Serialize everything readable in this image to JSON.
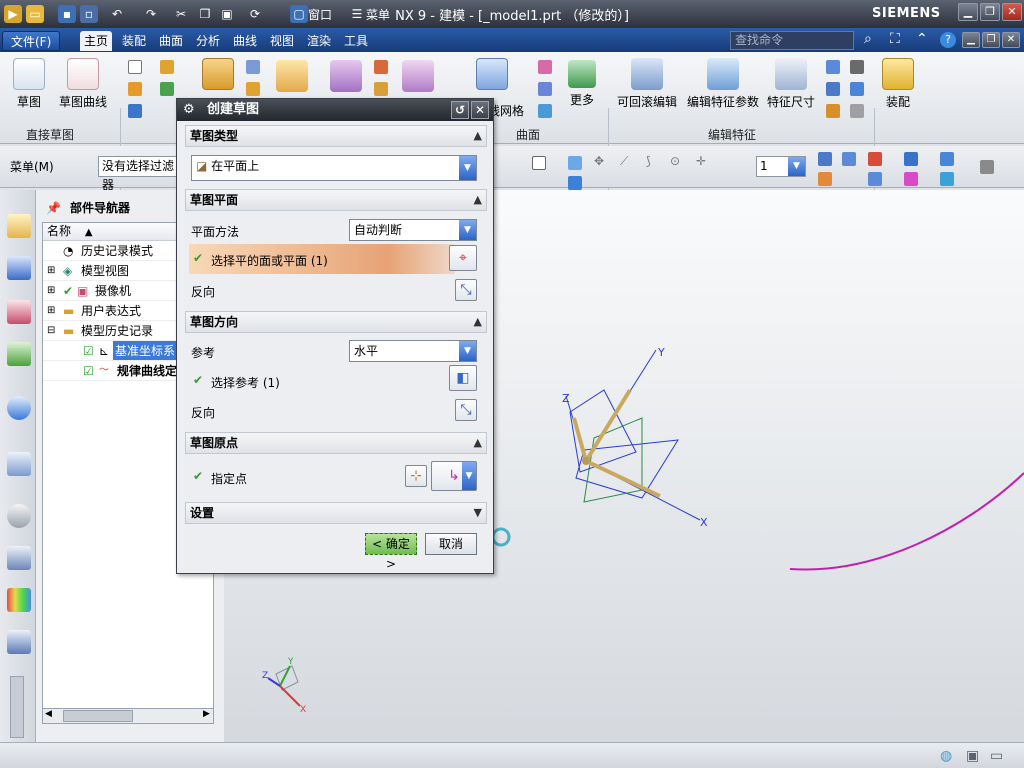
{
  "window": {
    "title": "NX 9 - 建模 - [_model1.prt （修改的）]",
    "brand": "SIEMENS",
    "quick_access": {
      "window_label": "窗口",
      "menu_label": "菜单"
    }
  },
  "menubar": {
    "tabs": [
      "文件(F)",
      "主页",
      "装配",
      "曲面",
      "分析",
      "曲线",
      "视图",
      "渲染",
      "工具"
    ],
    "active_tab": "主页",
    "search_placeholder": "查找命令"
  },
  "ribbon": {
    "buttons": {
      "sketch": "草图",
      "sketch_curve": "草图曲线",
      "more": "更多",
      "rollback_edit": "可回滚编辑",
      "edit_feature_params": "编辑特征参数",
      "feature_dims": "特征尺寸",
      "assembly": "装配"
    },
    "groups": {
      "direct_sketch": "直接草图",
      "surface": "曲面",
      "edit_feature": "编辑特征"
    },
    "partial_labels": {
      "mesh_label": "通过曲线网格"
    }
  },
  "toolbar2": {
    "menu_label": "菜单(M)",
    "filter_value": "没有选择过滤器",
    "layer_value": "1"
  },
  "navigator": {
    "title": "部件导航器",
    "column_header": "名称",
    "rows": [
      {
        "label": "历史记录模式"
      },
      {
        "label": "模型视图"
      },
      {
        "label": "摄像机"
      },
      {
        "label": "用户表达式"
      },
      {
        "label": "模型历史记录"
      },
      {
        "label": "基准坐标系"
      },
      {
        "label": "规律曲线定"
      }
    ]
  },
  "dialog": {
    "title": "创建草图",
    "sketch_type": {
      "header": "草图类型",
      "value": "在平面上"
    },
    "sketch_plane": {
      "header": "草图平面",
      "method_label": "平面方法",
      "method_value": "自动判断",
      "select_label": "选择平的面或平面 (1)",
      "reverse_label": "反向"
    },
    "sketch_orientation": {
      "header": "草图方向",
      "reference_label": "参考",
      "reference_value": "水平",
      "select_ref_label": "选择参考 (1)",
      "reverse_label": "反向"
    },
    "sketch_origin": {
      "header": "草图原点",
      "point_label": "指定点"
    },
    "settings": {
      "header": "设置"
    },
    "ok_label": "< 确定 >",
    "cancel_label": "取消"
  },
  "viewport": {
    "axis_labels": {
      "x": "X",
      "y": "Y",
      "z": "Z"
    },
    "curve_color": "#c21fb0"
  },
  "colors": {
    "accent": "#2a5ba8",
    "highlight": "#e7a375",
    "ok": "#6fbc4e"
  }
}
